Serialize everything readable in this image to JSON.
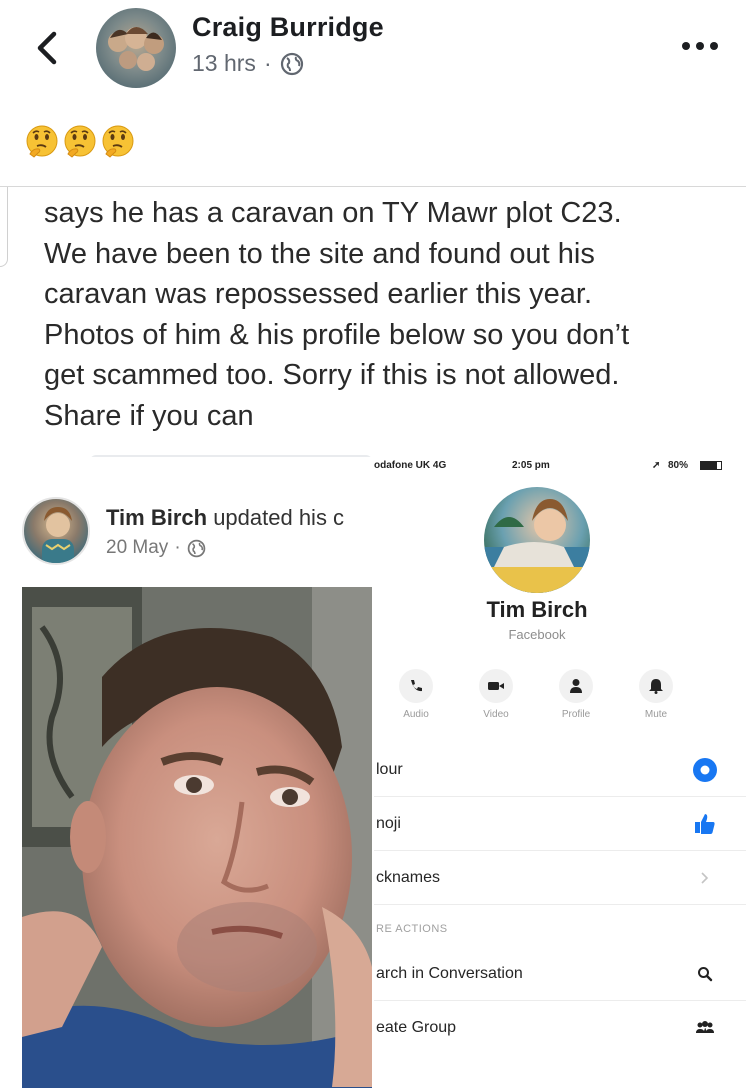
{
  "header": {
    "author": "Craig Burridge",
    "time": "13 hrs",
    "separator": "·",
    "privacy_icon": "globe-icon",
    "back_icon": "chevron-left-icon",
    "more_icon": "ellipsis-icon"
  },
  "post": {
    "emojis": [
      "thinking-face-emoji",
      "thinking-face-emoji",
      "thinking-face-emoji"
    ],
    "shared_text_lines": [
      "says he has a caravan on TY Mawr plot C23.",
      "We have been to the site and found out his",
      "caravan was repossessed earlier this year.",
      "Photos of him & his profile below so you don’t",
      "get scammed too. Sorry if this is not allowed.",
      "Share if you can"
    ]
  },
  "profile_update": {
    "name": "Tim Birch",
    "action": "updated his c",
    "date": "20 May",
    "separator": "·"
  },
  "messenger": {
    "status": {
      "carrier": "odafone UK  4G",
      "time": "2:05 pm",
      "battery": "80%"
    },
    "name": "Tim Birch",
    "subtitle": "Facebook",
    "actions": [
      "Audio",
      "Video",
      "Profile",
      "Mute"
    ],
    "rows": {
      "colour": "lour",
      "emoji": "noji",
      "nicknames": "cknames",
      "section": "RE ACTIONS",
      "search": "arch in Conversation",
      "group": "eate Group"
    },
    "accent_color": "#1877f2"
  }
}
